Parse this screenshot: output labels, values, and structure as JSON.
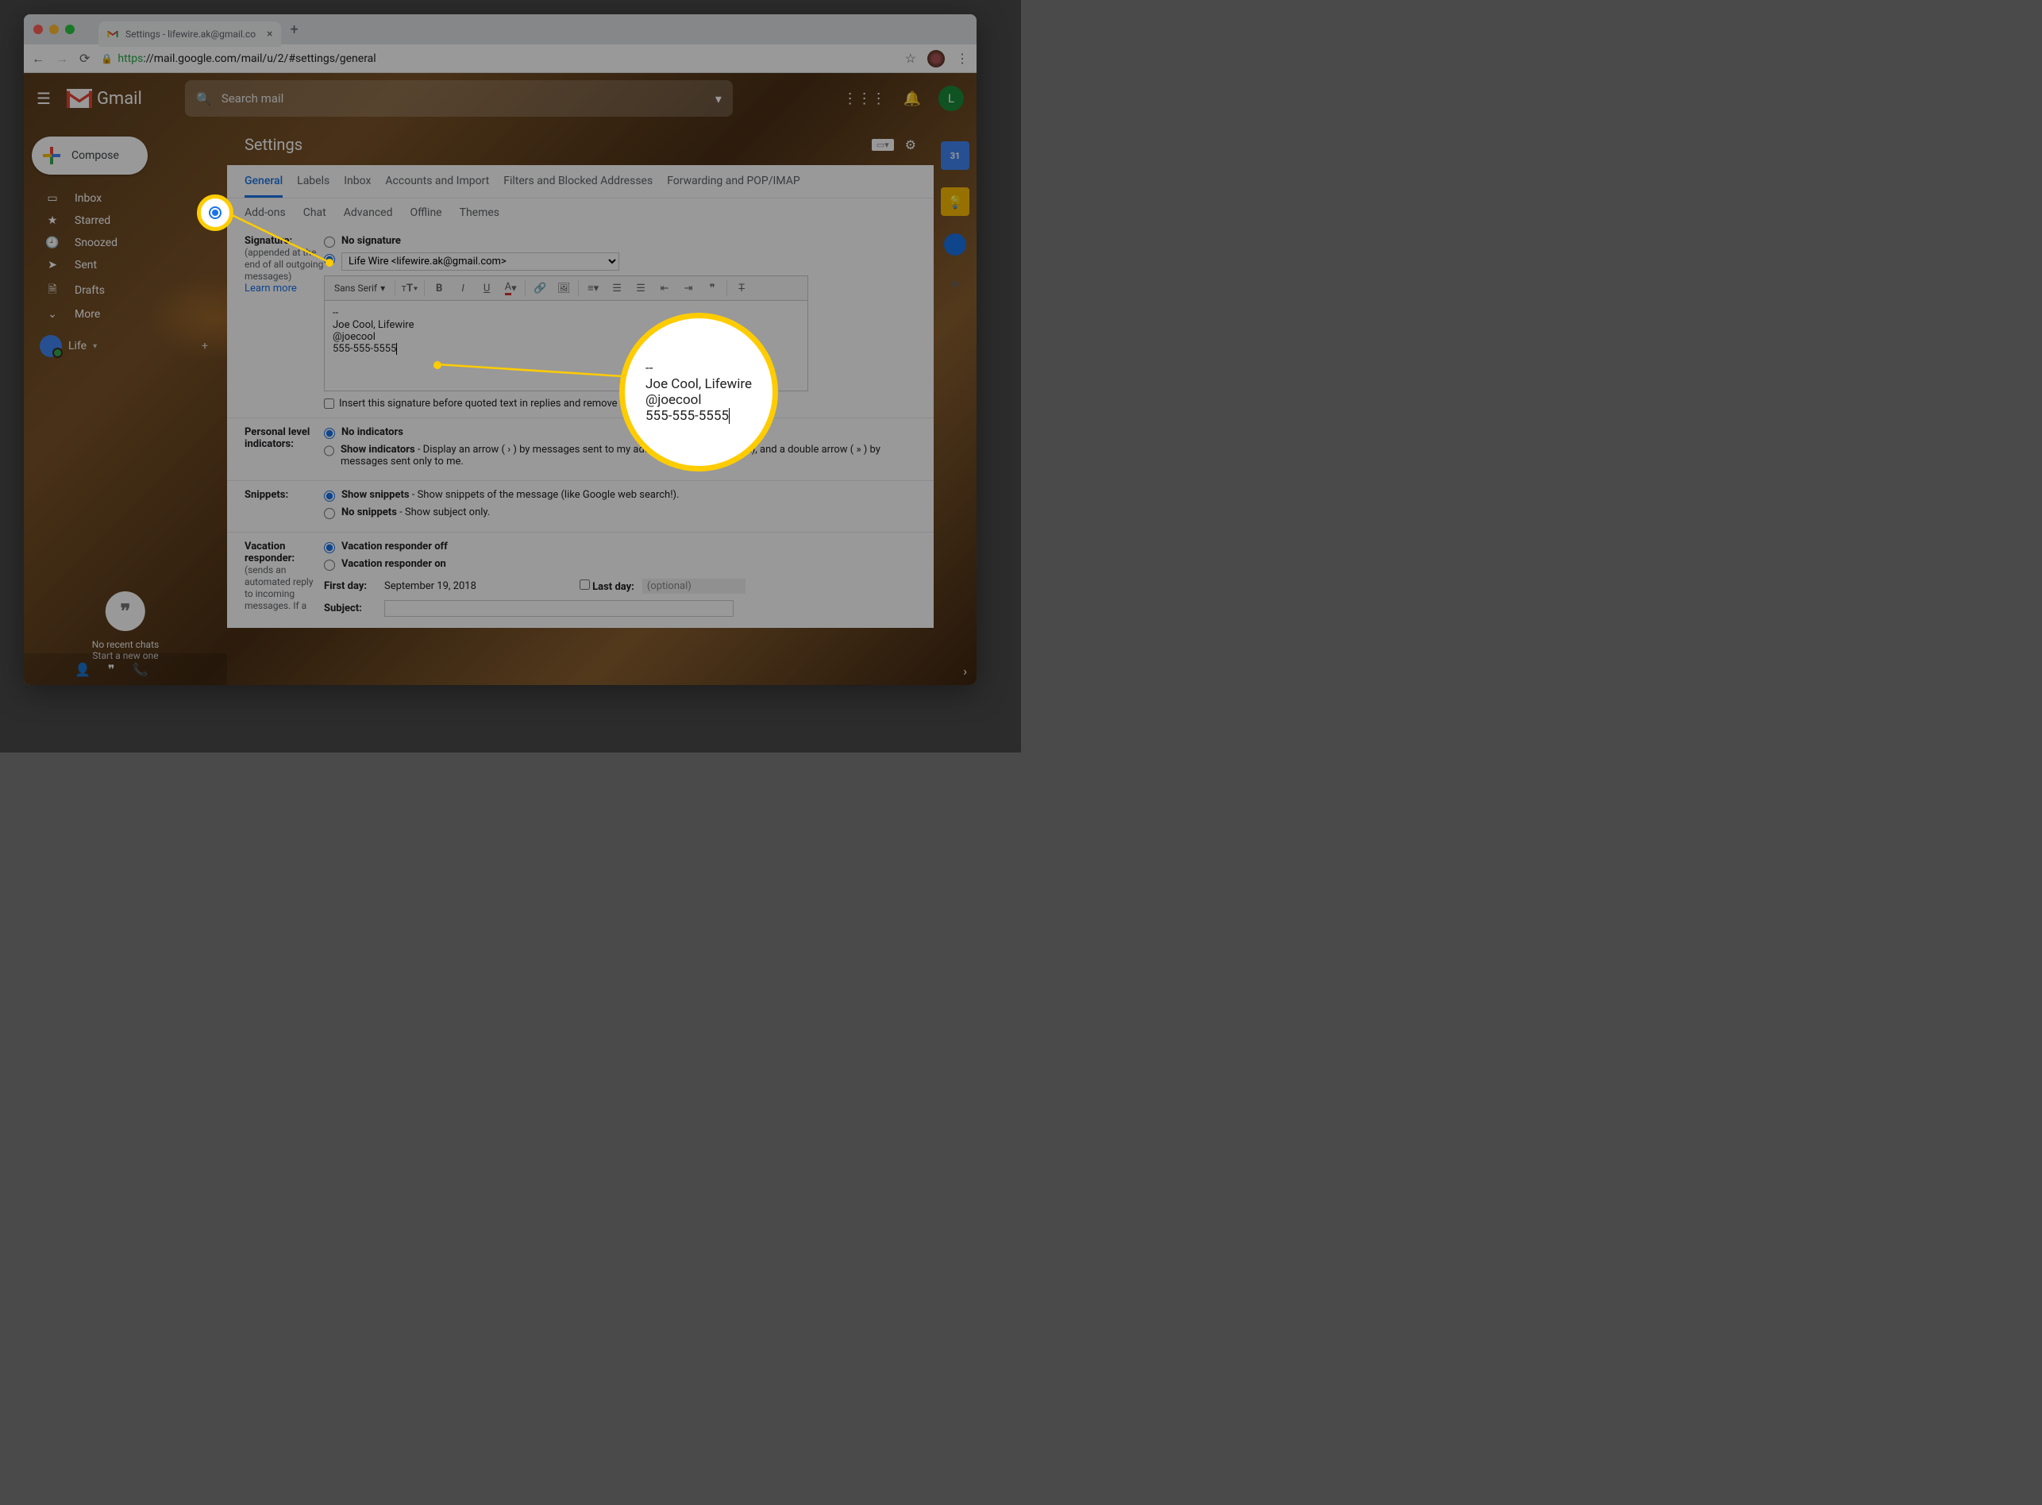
{
  "browser": {
    "tab_title": "Settings - lifewire.ak@gmail.co",
    "url_proto": "https",
    "url_rest": "://mail.google.com/mail/u/2/#settings/general"
  },
  "gmail": {
    "brand": "Gmail",
    "search_placeholder": "Search mail",
    "user_initial": "L"
  },
  "sidebar": {
    "compose": "Compose",
    "items": [
      {
        "icon": "inbox-icon",
        "label": "Inbox"
      },
      {
        "icon": "star-icon",
        "label": "Starred"
      },
      {
        "icon": "clock-icon",
        "label": "Snoozed"
      },
      {
        "icon": "send-icon",
        "label": "Sent"
      },
      {
        "icon": "file-icon",
        "label": "Drafts"
      },
      {
        "icon": "chevron-down-icon",
        "label": "More"
      }
    ],
    "account_name": "Life",
    "hangouts_line1": "No recent chats",
    "hangouts_line2": "Start a new one"
  },
  "settings": {
    "title": "Settings",
    "tabs1": [
      "General",
      "Labels",
      "Inbox",
      "Accounts and Import",
      "Filters and Blocked Addresses",
      "Forwarding and POP/IMAP"
    ],
    "tabs2": [
      "Add-ons",
      "Chat",
      "Advanced",
      "Offline",
      "Themes"
    ],
    "active_tab": "General"
  },
  "signature": {
    "label": "Signature:",
    "sub": "(appended at the end of all outgoing messages)",
    "learn": "Learn more",
    "opt_none": "No signature",
    "dropdown_value": "Life Wire <lifewire.ak@gmail.com>",
    "font_label": "Sans Serif",
    "content_l1": "--",
    "content_l2": "Joe Cool, Lifewire",
    "content_l3": "@joecool",
    "content_l4": "555-555-5555",
    "insert_label": "Insert this signature before quoted text in replies and remove the \"--\" line that precedes it."
  },
  "personal": {
    "label": "Personal level indicators:",
    "opt1_bold": "No indicators",
    "opt2_bold": "Show indicators",
    "opt2_rest": " - Display an arrow ( › ) by messages sent to my address (not a mailing list), and a double arrow ( » ) by messages sent only to me."
  },
  "snippets": {
    "label": "Snippets:",
    "opt1_bold": "Show snippets",
    "opt1_rest": " - Show snippets of the message (like Google web search!).",
    "opt2_bold": "No snippets",
    "opt2_rest": " - Show subject only."
  },
  "vacation": {
    "label": "Vacation responder:",
    "sub": "(sends an automated reply to incoming messages. If a",
    "opt1": "Vacation responder off",
    "opt2": "Vacation responder on",
    "first_day_label": "First day:",
    "first_day_value": "September 19, 2018",
    "last_day_label": "Last day:",
    "last_day_value": "(optional)",
    "subject_label": "Subject:"
  },
  "callout": {
    "l1": "--",
    "l2": "Joe Cool, Lifewire",
    "l3": "@joecool",
    "l4": "555-555-5555"
  },
  "rail": {
    "cal": "31"
  }
}
